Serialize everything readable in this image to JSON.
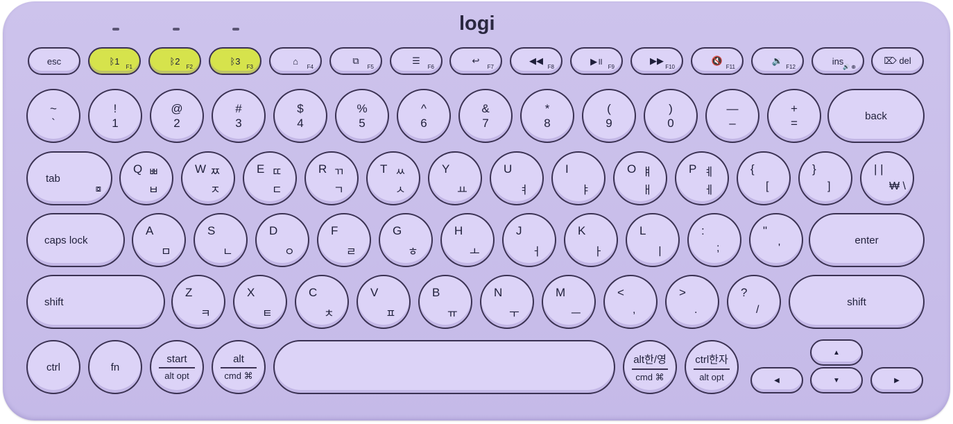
{
  "brand": "logi",
  "fn_row": [
    {
      "label": "esc",
      "sub": ""
    },
    {
      "label": "ᛒ1",
      "sub": "F1"
    },
    {
      "label": "ᛒ2",
      "sub": "F2"
    },
    {
      "label": "ᛒ3",
      "sub": "F3"
    },
    {
      "label": "⌂",
      "sub": "F4"
    },
    {
      "label": "⧉",
      "sub": "F5"
    },
    {
      "label": "☰",
      "sub": "F6"
    },
    {
      "label": "↩",
      "sub": "F7"
    },
    {
      "label": "◀◀",
      "sub": "F8"
    },
    {
      "label": "▶॥",
      "sub": "F9"
    },
    {
      "label": "▶▶",
      "sub": "F10"
    },
    {
      "label": "🔇",
      "sub": "F11"
    },
    {
      "label": "🔉",
      "sub": "F12"
    },
    {
      "label": "ins",
      "sub": "🔊 ⊕"
    },
    {
      "label": "⌦ del",
      "sub": ""
    }
  ],
  "num_row": [
    {
      "top": "~",
      "bottom": "`"
    },
    {
      "top": "!",
      "bottom": "1"
    },
    {
      "top": "@",
      "bottom": "2"
    },
    {
      "top": "#",
      "bottom": "3"
    },
    {
      "top": "$",
      "bottom": "4"
    },
    {
      "top": "%",
      "bottom": "5"
    },
    {
      "top": "^",
      "bottom": "6"
    },
    {
      "top": "&",
      "bottom": "7"
    },
    {
      "top": "*",
      "bottom": "8"
    },
    {
      "top": "(",
      "bottom": "9"
    },
    {
      "top": ")",
      "bottom": "0"
    },
    {
      "top": "—",
      "bottom": "–"
    },
    {
      "top": "+",
      "bottom": "="
    }
  ],
  "back": "back",
  "tab": "tab",
  "q_row": [
    {
      "l": "Q",
      "k1": "ㅃ",
      "k2": "ㅂ"
    },
    {
      "l": "W",
      "k1": "ㅉ",
      "k2": "ㅈ"
    },
    {
      "l": "E",
      "k1": "ㄸ",
      "k2": "ㄷ"
    },
    {
      "l": "R",
      "k1": "ㄲ",
      "k2": "ㄱ"
    },
    {
      "l": "T",
      "k1": "ㅆ",
      "k2": "ㅅ"
    },
    {
      "l": "Y",
      "k1": "",
      "k2": "ㅛ"
    },
    {
      "l": "U",
      "k1": "",
      "k2": "ㅕ"
    },
    {
      "l": "I",
      "k1": "",
      "k2": "ㅑ"
    },
    {
      "l": "O",
      "k1": "ㅒ",
      "k2": "ㅐ"
    },
    {
      "l": "P",
      "k1": "ㅖ",
      "k2": "ㅔ"
    },
    {
      "l": "{",
      "k1": "",
      "k2": "["
    },
    {
      "l": "}",
      "k1": "",
      "k2": "]"
    },
    {
      "l": "| |",
      "k1": "",
      "k2": "₩ \\"
    }
  ],
  "caps": "caps lock",
  "a_row": [
    {
      "l": "A",
      "k": "ㅁ"
    },
    {
      "l": "S",
      "k": "ㄴ"
    },
    {
      "l": "D",
      "k": "ㅇ"
    },
    {
      "l": "F",
      "k": "ㄹ"
    },
    {
      "l": "G",
      "k": "ㅎ"
    },
    {
      "l": "H",
      "k": "ㅗ"
    },
    {
      "l": "J",
      "k": "ㅓ"
    },
    {
      "l": "K",
      "k": "ㅏ"
    },
    {
      "l": "L",
      "k": "ㅣ"
    },
    {
      "l": ":",
      "k": ";"
    },
    {
      "l": "\"",
      "k": "'"
    }
  ],
  "enter": "enter",
  "shift_l": "shift",
  "shift_r": "shift",
  "z_row": [
    {
      "l": "Z",
      "k": "ㅋ"
    },
    {
      "l": "X",
      "k": "ㅌ"
    },
    {
      "l": "C",
      "k": "ㅊ"
    },
    {
      "l": "V",
      "k": "ㅍ"
    },
    {
      "l": "B",
      "k": "ㅠ"
    },
    {
      "l": "N",
      "k": "ㅜ"
    },
    {
      "l": "M",
      "k": "ㅡ"
    },
    {
      "l": "<",
      "k": ","
    },
    {
      "l": ">",
      "k": "."
    },
    {
      "l": "?",
      "k": "/"
    }
  ],
  "bottom": {
    "ctrl": "ctrl",
    "fn": "fn",
    "start_top": "start",
    "start_bottom": "alt opt",
    "alt_top": "alt",
    "alt_bottom": "cmd ⌘",
    "altko_top": "alt한/영",
    "altko_bottom": "cmd ⌘",
    "ctrlko_top": "ctrl한자",
    "ctrlko_bottom": "alt opt"
  },
  "arrows": {
    "up": "▲",
    "down": "▼",
    "left": "◀",
    "right": "▶"
  },
  "colors": {
    "body": "#c5bae8",
    "key": "#dcd3f7",
    "bt_key": "#d6e34c",
    "outline": "#3a3152"
  }
}
